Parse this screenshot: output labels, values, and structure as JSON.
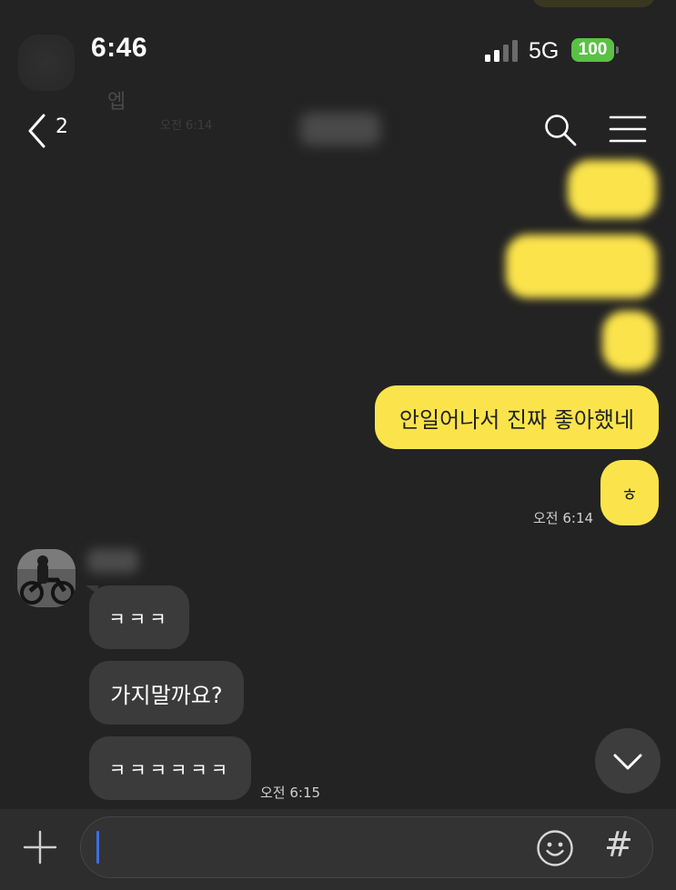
{
  "status_bar": {
    "time": "6:46",
    "network": "5G",
    "battery": "100"
  },
  "background_ghost": {
    "text": "엡",
    "time": "오전 6:14"
  },
  "header": {
    "back_count": "2",
    "icons": [
      "chevron-left-icon",
      "search-icon",
      "hamburger-menu-icon"
    ]
  },
  "messages": {
    "outgoing": [
      {
        "text": "",
        "blurred": true
      },
      {
        "text": "",
        "blurred": true
      },
      {
        "text": "",
        "blurred": true
      },
      {
        "text": "안일어나서 진짜 좋아했네",
        "blurred": false
      },
      {
        "text": "ㅎ",
        "blurred": false
      }
    ],
    "outgoing_time": "오전 6:14",
    "incoming": [
      {
        "text": "ㅋㅋㅋ"
      },
      {
        "text": "가지말까요?"
      },
      {
        "text": "ㅋㅋㅋㅋㅋㅋ"
      }
    ],
    "incoming_time": "오전 6:15"
  },
  "input_bar": {
    "placeholder": "",
    "icons": [
      "plus-icon",
      "emoji-icon",
      "hashtag-icon"
    ],
    "hash_symbol": "#"
  },
  "colors": {
    "background": "#232323",
    "outgoing_bubble": "#fbe44b",
    "incoming_bubble": "#3b3b3b",
    "battery": "#5ac146",
    "caret": "#3d6fe0"
  }
}
